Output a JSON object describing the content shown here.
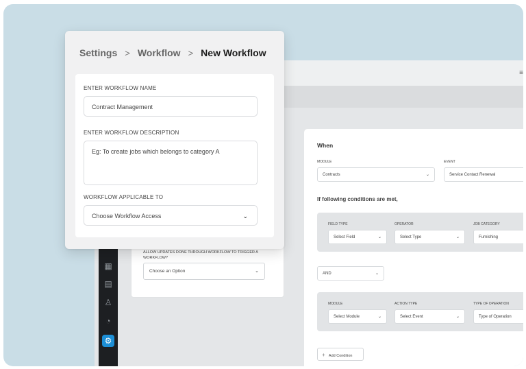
{
  "background": {
    "menu_icon": "hamburger-icon",
    "left_card": {
      "label": "ALLOW UPDATES DONE THROUGH WORKFLOW TO TRIGGER A WORKFLOW?",
      "select_value": "Choose an Option"
    },
    "sidebar_icons": [
      "calendar-icon",
      "building-icon",
      "user-icon",
      "tag-icon",
      "settings-icon"
    ],
    "when_panel": {
      "title": "When",
      "module_label": "MODULE",
      "module_value": "Contracts",
      "event_label": "EVENT",
      "event_value": "Service Contact Renewal",
      "conditions_title": "If following conditions are met,",
      "field_type_label": "FIELD TYPE",
      "field_type_value": "Select Field",
      "operator_label": "OPERATOR",
      "operator_value": "Select Type",
      "job_category_label": "JOB CATEGORY",
      "job_category_value": "Furnishing",
      "logic_value": "AND",
      "module2_label": "MODULE",
      "module2_value": "Select Module",
      "action_type_label": "ACTION TYPE",
      "action_type_value": "Select Event",
      "type_of_operation_label": "TYPE OF OPERATION",
      "type_of_operation_value": "Type of Operation",
      "add_condition_label": "Add Condition"
    }
  },
  "modal": {
    "breadcrumb": [
      "Settings",
      "Workflow",
      "New Workflow"
    ],
    "name_label": "ENTER WORKFLOW NAME",
    "name_value": "Contract Management",
    "description_label": "ENTER WORKFLOW DESCRIPTION",
    "description_placeholder": "Eg: To create jobs which belongs to category A",
    "applicable_label": "WORKFLOW APPLICABLE TO",
    "applicable_value": "Choose Workflow Access"
  },
  "colors": {
    "backdrop": "#c9dde6",
    "accent": "#1d8fd6",
    "sidebar": "#1d1f22"
  }
}
